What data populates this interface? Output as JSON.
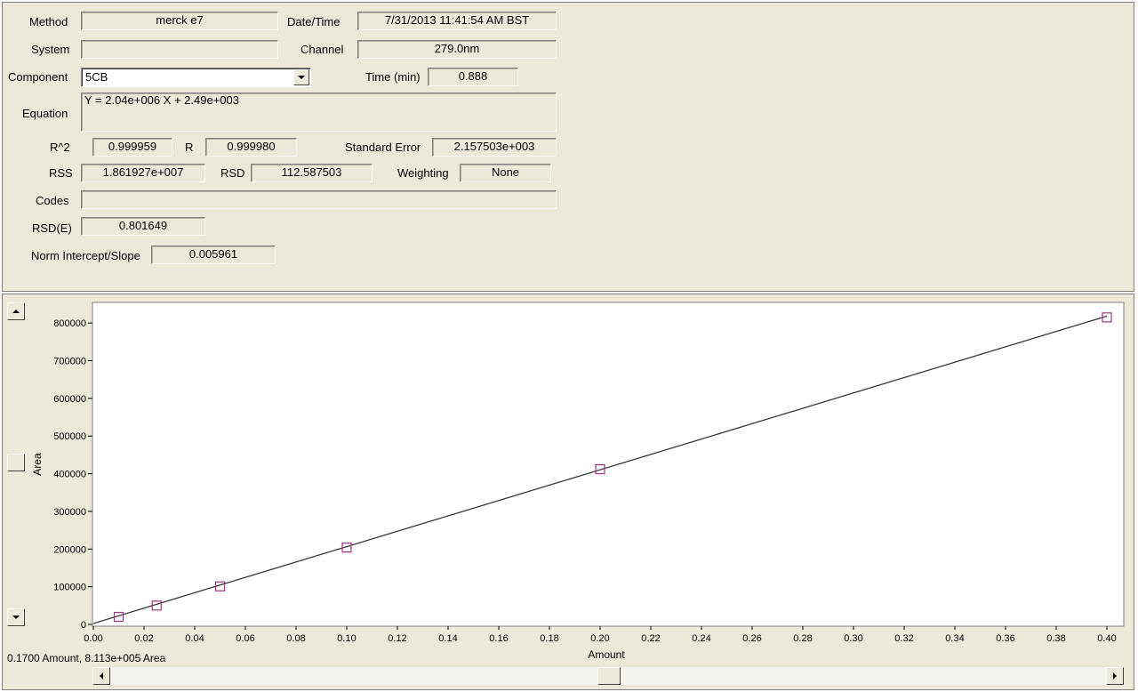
{
  "form": {
    "method_label": "Method",
    "method_value": "merck e7",
    "datetime_label": "Date/Time",
    "datetime_value": "7/31/2013 11:41:54 AM BST",
    "system_label": "System",
    "system_value": "",
    "channel_label": "Channel",
    "channel_value": "279.0nm",
    "component_label": "Component",
    "component_value": "5CB",
    "time_label": "Time (min)",
    "time_value": "0.888",
    "equation_label": "Equation",
    "equation_value": "Y = 2.04e+006 X + 2.49e+003",
    "r2_label": "R^2",
    "r2_value": "0.999959",
    "r_label": "R",
    "r_value": "0.999980",
    "stderr_label": "Standard Error",
    "stderr_value": "2.157503e+003",
    "rss_label": "RSS",
    "rss_value": "1.861927e+007",
    "rsd_label": "RSD",
    "rsd_value": "112.587503",
    "weighting_label": "Weighting",
    "weighting_value": "None",
    "codes_label": "Codes",
    "codes_value": "",
    "rsde_label": "RSD(E)",
    "rsde_value": "0.801649",
    "norm_label": "Norm Intercept/Slope",
    "norm_value": "0.005961"
  },
  "status_text": "0.1700 Amount, 8.113e+005 Area",
  "colors": {
    "panel": "#ece9d8",
    "line": "#3a3a3a",
    "marker": "#a0308a"
  },
  "chart_data": {
    "type": "scatter",
    "xlabel": "Amount",
    "ylabel": "Area",
    "xlim": [
      0,
      0.4
    ],
    "ylim": [
      0,
      850000
    ],
    "xticks": [
      "0.00",
      "0.02",
      "0.04",
      "0.06",
      "0.08",
      "0.10",
      "0.12",
      "0.14",
      "0.16",
      "0.18",
      "0.20",
      "0.22",
      "0.24",
      "0.26",
      "0.28",
      "0.30",
      "0.32",
      "0.34",
      "0.36",
      "0.38",
      "0.40"
    ],
    "yticks": [
      "0",
      "100000",
      "200000",
      "300000",
      "400000",
      "500000",
      "600000",
      "700000",
      "800000"
    ],
    "points": [
      {
        "x": 0.01,
        "y": 20000
      },
      {
        "x": 0.025,
        "y": 50000
      },
      {
        "x": 0.05,
        "y": 101000
      },
      {
        "x": 0.1,
        "y": 204000
      },
      {
        "x": 0.2,
        "y": 412000
      },
      {
        "x": 0.4,
        "y": 815000
      }
    ],
    "fit": {
      "slope": 2040000,
      "intercept": 2490
    },
    "grid": false
  }
}
